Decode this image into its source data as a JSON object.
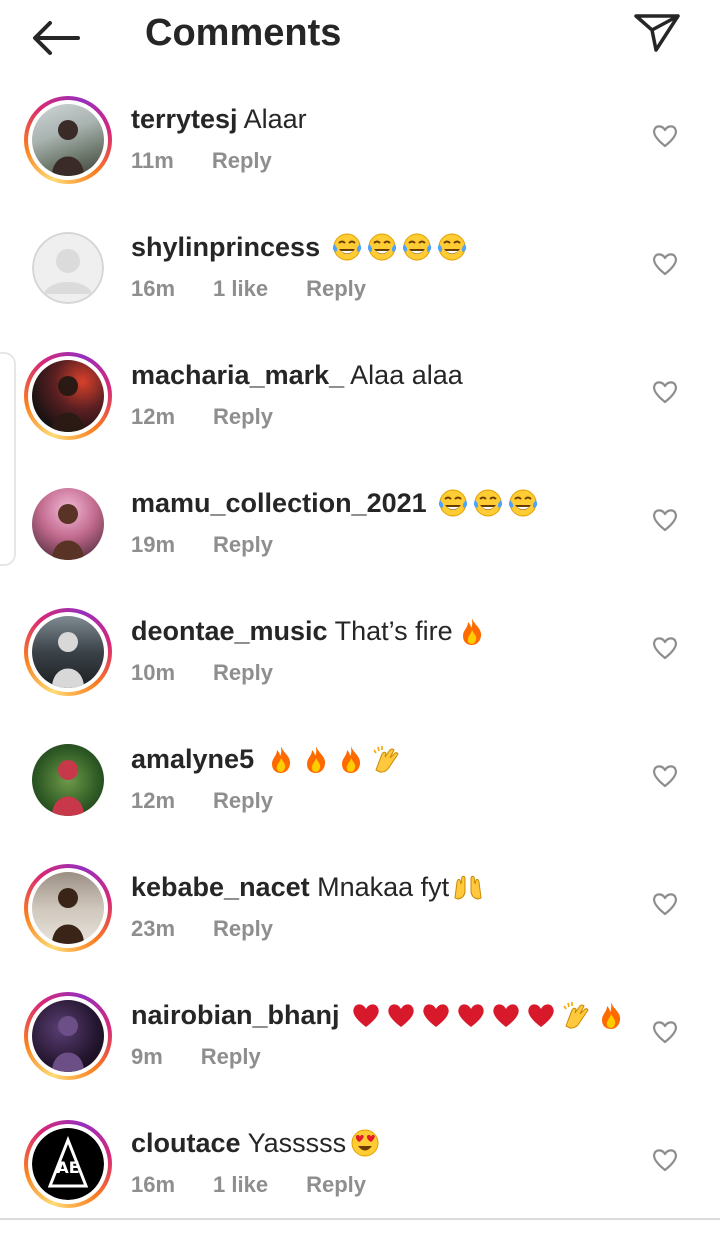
{
  "header": {
    "title": "Comments"
  },
  "comments": [
    {
      "username": "terrytesj",
      "text": "Alaar",
      "time": "11m",
      "likes": "",
      "reply": "Reply",
      "emojis": []
    },
    {
      "username": "shylinprincess",
      "text": "",
      "time": "16m",
      "likes": "1 like",
      "reply": "Reply",
      "emojis": [
        "tears-of-joy-emoji",
        "tears-of-joy-emoji",
        "tears-of-joy-emoji",
        "tears-of-joy-emoji"
      ]
    },
    {
      "username": "macharia_mark_",
      "text": "Alaa alaa",
      "time": "12m",
      "likes": "",
      "reply": "Reply",
      "emojis": []
    },
    {
      "username": "mamu_collection_2021",
      "text": "",
      "time": "19m",
      "likes": "",
      "reply": "Reply",
      "emojis": [
        "tears-of-joy-emoji",
        "tears-of-joy-emoji",
        "tears-of-joy-emoji"
      ]
    },
    {
      "username": "deontae_music",
      "text": "That’s fire",
      "time": "10m",
      "likes": "",
      "reply": "Reply",
      "emojis": [
        "fire-emoji"
      ]
    },
    {
      "username": "amalyne5",
      "text": "",
      "time": "12m",
      "likes": "",
      "reply": "Reply",
      "emojis": [
        "fire-emoji",
        "fire-emoji",
        "fire-emoji",
        "clapping-hands-emoji"
      ]
    },
    {
      "username": "kebabe_nacet",
      "text": "Mnakaa fyt",
      "time": "23m",
      "likes": "",
      "reply": "Reply",
      "emojis": [
        "raising-hands-emoji"
      ]
    },
    {
      "username": "nairobian_bhanj",
      "text": "",
      "time": "9m",
      "likes": "",
      "reply": "Reply",
      "emojis": [
        "red-heart-emoji",
        "red-heart-emoji",
        "red-heart-emoji",
        "red-heart-emoji",
        "red-heart-emoji",
        "red-heart-emoji",
        "clapping-hands-emoji",
        "fire-emoji"
      ]
    },
    {
      "username": "cloutace",
      "text": "Yasssss",
      "time": "16m",
      "likes": "1 like",
      "reply": "Reply",
      "emojis": [
        "heart-eyes-emoji"
      ]
    }
  ],
  "colors": {
    "text": "#262626",
    "meta": "#8e8e8e",
    "heart_outline": "#8e8e8e"
  }
}
